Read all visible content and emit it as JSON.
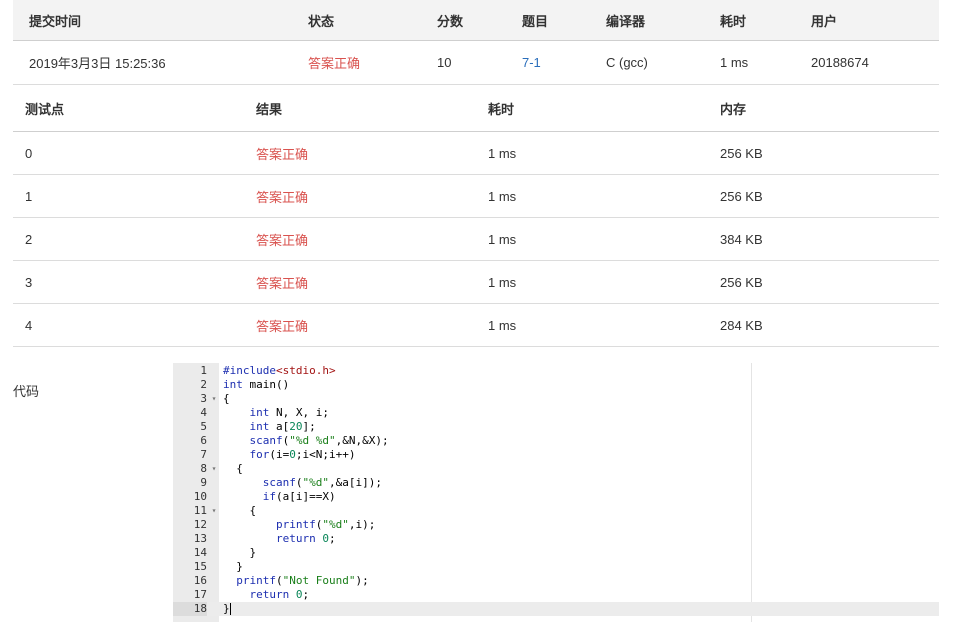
{
  "summary": {
    "headers": [
      "提交时间",
      "状态",
      "分数",
      "题目",
      "编译器",
      "耗时",
      "用户"
    ],
    "submit_time": "2019年3月3日 15:25:36",
    "status": "答案正确",
    "score": "10",
    "problem": "7-1",
    "compiler": "C (gcc)",
    "time": "1 ms",
    "user": "20188674"
  },
  "tests": {
    "headers": [
      "测试点",
      "结果",
      "耗时",
      "内存"
    ],
    "rows": [
      {
        "id": "0",
        "result": "答案正确",
        "time": "1 ms",
        "memory": "256 KB"
      },
      {
        "id": "1",
        "result": "答案正确",
        "time": "1 ms",
        "memory": "256 KB"
      },
      {
        "id": "2",
        "result": "答案正确",
        "time": "1 ms",
        "memory": "384 KB"
      },
      {
        "id": "3",
        "result": "答案正确",
        "time": "1 ms",
        "memory": "256 KB"
      },
      {
        "id": "4",
        "result": "答案正确",
        "time": "1 ms",
        "memory": "284 KB"
      }
    ]
  },
  "code": {
    "label": "代码",
    "lines": [
      {
        "n": "1",
        "text": "#include<stdio.h>"
      },
      {
        "n": "2",
        "text": "int main()"
      },
      {
        "n": "3",
        "text": "{"
      },
      {
        "n": "4",
        "text": "    int N, X, i;"
      },
      {
        "n": "5",
        "text": "    int a[20];"
      },
      {
        "n": "6",
        "text": "    scanf(\"%d %d\",&N,&X);"
      },
      {
        "n": "7",
        "text": "    for(i=0;i<N;i++)"
      },
      {
        "n": "8",
        "text": "  {"
      },
      {
        "n": "9",
        "text": "      scanf(\"%d\",&a[i]);"
      },
      {
        "n": "10",
        "text": "      if(a[i]==X)"
      },
      {
        "n": "11",
        "text": "    {"
      },
      {
        "n": "12",
        "text": "        printf(\"%d\",i);"
      },
      {
        "n": "13",
        "text": "        return 0;"
      },
      {
        "n": "14",
        "text": "    }"
      },
      {
        "n": "15",
        "text": "  }"
      },
      {
        "n": "16",
        "text": "  printf(\"Not Found\");"
      },
      {
        "n": "17",
        "text": "    return 0;"
      },
      {
        "n": "18",
        "text": "}"
      }
    ],
    "fold_icon": "triangle-down-icon"
  }
}
